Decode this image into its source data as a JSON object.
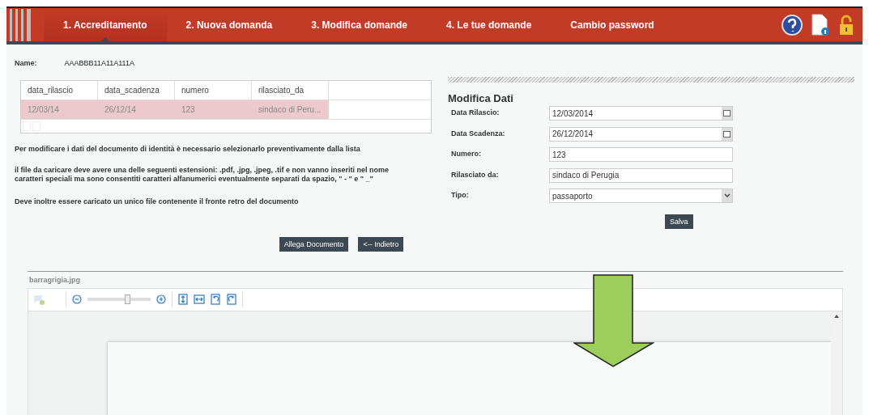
{
  "nav": {
    "tabs": [
      {
        "label": "1. Accreditamento",
        "selected": true
      },
      {
        "label": "2. Nuova domanda",
        "selected": false
      },
      {
        "label": "3. Modifica domande",
        "selected": false
      },
      {
        "label": "4. Le tue domande",
        "selected": false
      },
      {
        "label": "Cambio password",
        "selected": false
      }
    ]
  },
  "name": {
    "label": "Name:",
    "value": "AAABBB11A11A111A"
  },
  "table": {
    "columns": [
      "data_rilascio",
      "data_scadenza",
      "numero",
      "rilasciato_da"
    ],
    "rows": [
      {
        "cells": [
          "12/03/14",
          "26/12/14",
          "123",
          "sindaco di Peru..."
        ],
        "selected": true
      }
    ]
  },
  "notes": [
    "Per modificare i dati del documento di identità è necessario selezionarlo preventivamente dalla lista",
    "il file da caricare deve avere una delle seguenti estensioni: .pdf, .jpg, .jpeg, .tif e non vanno inseriti nel nome caratteri speciali ma sono consentiti caratteri alfanumerici eventualmente separati da spazio, \" - \" e \" _\"",
    "Deve inoltre essere caricato un unico file contenente il fronte retro del documento"
  ],
  "form": {
    "title": "Modifica Dati",
    "fields": [
      {
        "kind": "date",
        "label": "Data Rilascio:",
        "value": "12/03/2014"
      },
      {
        "kind": "date",
        "label": "Data Scadenza:",
        "value": "26/12/2014"
      },
      {
        "kind": "text",
        "label": "Numero:",
        "value": "123"
      },
      {
        "kind": "text",
        "label": "Rilasciato da:",
        "value": "sindaco di Perugia"
      },
      {
        "kind": "select",
        "label": "Tipo:",
        "value": "passaporto"
      }
    ],
    "submit": "Salva"
  },
  "actions": [
    "Allega Documento",
    "<-- Indietro"
  ],
  "viewer": {
    "filename": "barragrigia.jpg",
    "zoom": {
      "level": 0.65
    }
  }
}
